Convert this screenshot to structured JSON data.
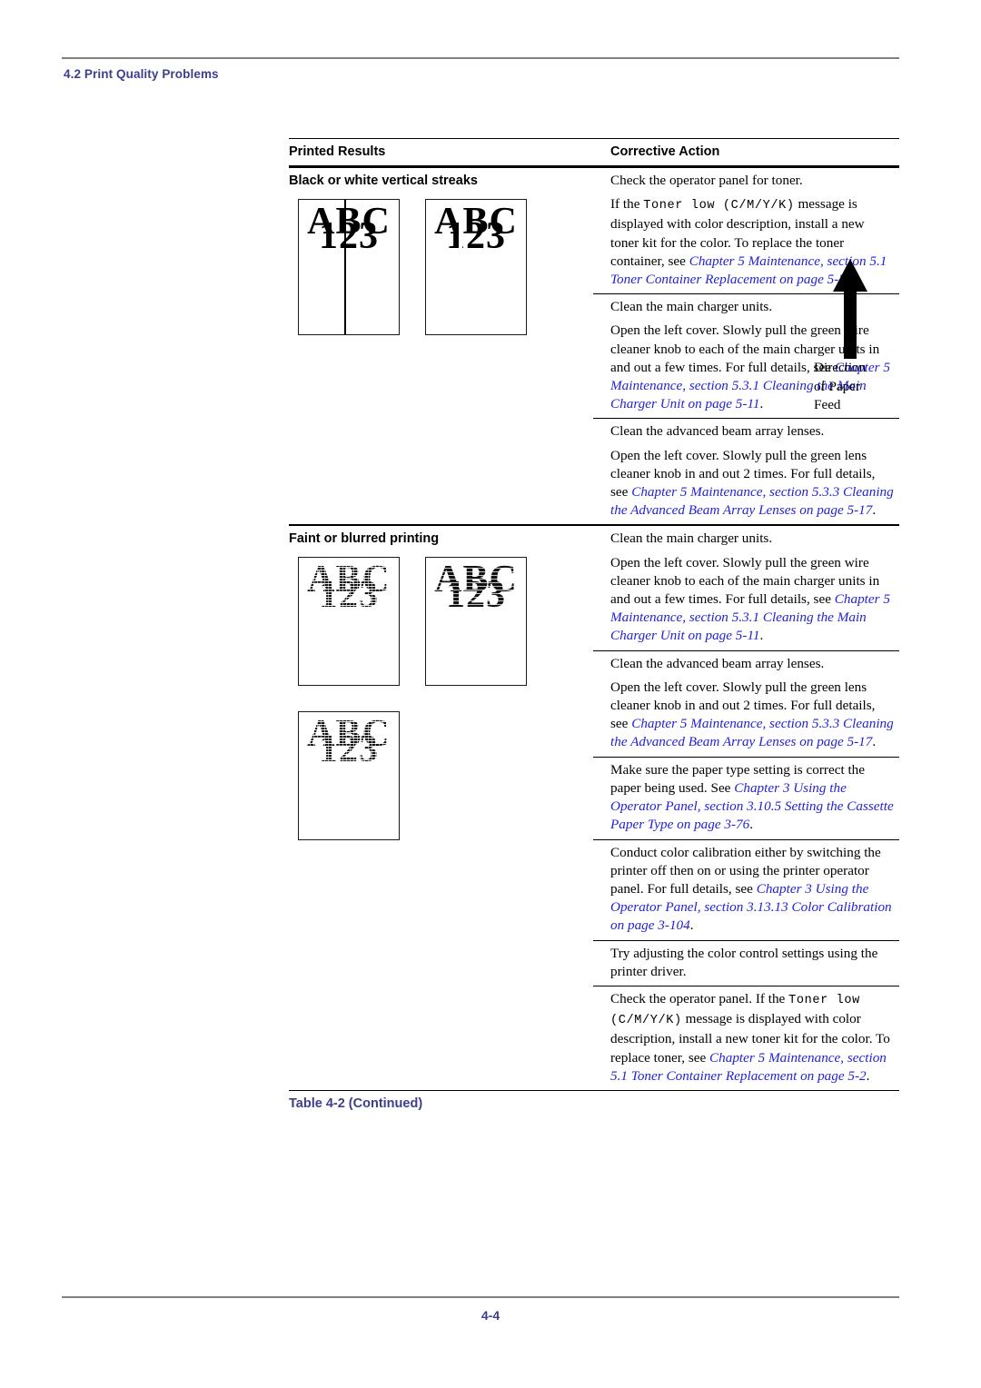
{
  "header": {
    "section_label": "4.2 Print Quality Problems"
  },
  "table": {
    "columns": {
      "left": "Printed Results",
      "right": "Corrective Action"
    },
    "caption": "Table 4-2  (Continued)",
    "illustration": {
      "sample_text_line1": "ABC",
      "sample_text_line2": "123",
      "feed_direction_label": "Direction of Paper Feed",
      "feed_label_line1": "Direction",
      "feed_label_line2": "of Paper",
      "feed_label_line3": "Feed"
    },
    "rows": [
      {
        "symptom": "Black or white vertical streaks",
        "actions": [
          {
            "paragraphs": [
              {
                "text": "Check the operator panel for toner."
              },
              {
                "prefix": "If the ",
                "mono": "Toner low (C/M/Y/K)",
                "middle": " message is displayed with color description, install a new toner kit for the color. To replace the toner container, see ",
                "ref": "Chapter 5 Maintenance, section 5.1 Toner Container Replacement on page 5-2",
                "suffix": "."
              }
            ]
          },
          {
            "paragraphs": [
              {
                "text": "Clean the main charger units."
              },
              {
                "prefix": "Open the left cover. Slowly pull the green wire cleaner knob to each of the main charger units in and out a few times. For full details, see ",
                "ref": "Chapter 5 Maintenance, section 5.3.1 Cleaning the Main Charger Unit on page 5-11",
                "suffix": "."
              }
            ]
          },
          {
            "paragraphs": [
              {
                "text": "Clean the advanced beam array lenses."
              },
              {
                "prefix": "Open the left cover. Slowly pull the green lens cleaner knob in and out 2 times. For full details, see ",
                "ref": "Chapter 5 Maintenance, section 5.3.3 Cleaning the Advanced Beam Array Lenses on page 5-17",
                "suffix": "."
              }
            ]
          }
        ]
      },
      {
        "symptom": "Faint or blurred printing",
        "actions": [
          {
            "paragraphs": [
              {
                "text": "Clean the main charger units."
              },
              {
                "prefix": "Open the left cover. Slowly pull the green wire cleaner knob to each of the main charger units in and out a few times. For full details, see ",
                "ref": "Chapter 5 Maintenance, section 5.3.1 Cleaning the Main Charger Unit on page 5-11",
                "suffix": "."
              }
            ]
          },
          {
            "paragraphs": [
              {
                "text": "Clean the advanced beam array lenses."
              },
              {
                "prefix": "Open the left cover. Slowly pull the green lens cleaner knob in and out 2 times. For full details, see ",
                "ref": "Chapter 5 Maintenance, section 5.3.3 Cleaning the Advanced Beam Array Lenses on page 5-17",
                "suffix": "."
              }
            ]
          },
          {
            "paragraphs": [
              {
                "prefix": "Make sure the paper type setting is correct the paper being used. See ",
                "ref": "Chapter 3 Using the Operator Panel, section 3.10.5 Setting the Cassette Paper Type on page 3-76",
                "suffix": "."
              }
            ]
          },
          {
            "paragraphs": [
              {
                "prefix": "Conduct color calibration either by switching the printer off then on or using the printer operator panel. For full details, see ",
                "ref": "Chapter 3 Using the Operator Panel, section 3.13.13 Color Calibration on page 3-104",
                "suffix": "."
              }
            ]
          },
          {
            "paragraphs": [
              {
                "text": "Try adjusting the color control settings using the printer driver."
              }
            ]
          },
          {
            "paragraphs": [
              {
                "prefix": "Check the operator panel. If the ",
                "mono": "Toner low (C/M/Y/K)",
                "middle": " message is displayed with color description, install a new toner kit for the color. To replace toner, see ",
                "ref": "Chapter 5 Maintenance, section 5.1 Toner Container Replacement on page 5-2",
                "suffix": "."
              }
            ]
          }
        ]
      }
    ]
  },
  "footer": {
    "page_number": "4-4"
  },
  "colors": {
    "heading_blue": "#3d3f8c",
    "reference_blue": "#2222d8",
    "rule_gray": "#808080"
  }
}
